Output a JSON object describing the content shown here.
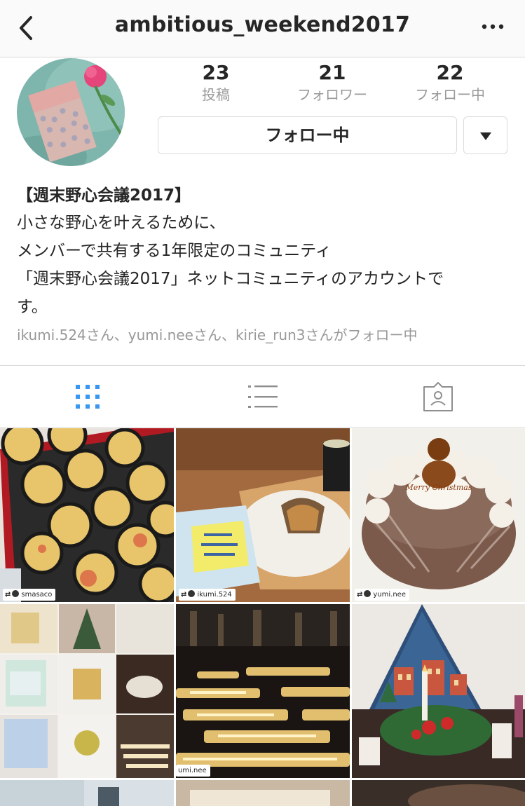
{
  "header": {
    "username": "ambitious_weekend2017"
  },
  "stats": [
    {
      "value": "23",
      "label": "投稿"
    },
    {
      "value": "21",
      "label": "フォロワー"
    },
    {
      "value": "22",
      "label": "フォロー中"
    }
  ],
  "actions": {
    "follow_label": "フォロー中"
  },
  "bio": {
    "name": "【週末野心会議2017】",
    "lines": [
      "小さな野心を叶えるために、",
      "メンバーで共有する1年限定のコミュニティ",
      "「週末野心会議2017」ネットコミュニティのアカウントで",
      "す。"
    ]
  },
  "followed_by": "ikumi.524さん、yumi.neeさん、kirie_run3さんがフォロー中",
  "posts": [
    {
      "content": "takoyaki",
      "repost_user": "smasaco"
    },
    {
      "content": "cake-book",
      "repost_user": "ikumi.524"
    },
    {
      "content": "christmas-cake",
      "repost_user": "yumi.nee",
      "cake_text": "Merry Christmas"
    },
    {
      "content": "collage",
      "repost_user": ""
    },
    {
      "content": "candles",
      "repost_user": "umi.nee"
    },
    {
      "content": "advent-calendar",
      "repost_user": ""
    }
  ],
  "colors": {
    "accent": "#3897f0",
    "muted": "#999999",
    "border": "#dbdbdb"
  }
}
